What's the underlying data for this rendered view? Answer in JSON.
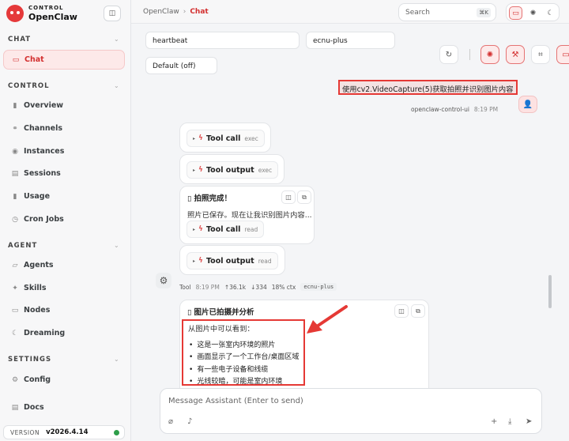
{
  "brand": {
    "sub": "CONTROL",
    "name": "OpenClaw"
  },
  "sidebar": {
    "sections": [
      {
        "label": "CHAT"
      },
      {
        "label": "CONTROL"
      },
      {
        "label": "AGENT"
      },
      {
        "label": "SETTINGS"
      }
    ],
    "items": [
      {
        "label": "Chat",
        "icon": "chat-icon"
      },
      {
        "label": "Overview",
        "icon": "bar-chart-icon"
      },
      {
        "label": "Channels",
        "icon": "link-icon"
      },
      {
        "label": "Instances",
        "icon": "broadcast-icon"
      },
      {
        "label": "Sessions",
        "icon": "document-icon"
      },
      {
        "label": "Usage",
        "icon": "bar-chart-icon"
      },
      {
        "label": "Cron Jobs",
        "icon": "clock-icon"
      },
      {
        "label": "Agents",
        "icon": "folder-icon"
      },
      {
        "label": "Skills",
        "icon": "sparkle-icon"
      },
      {
        "label": "Nodes",
        "icon": "monitor-icon"
      },
      {
        "label": "Dreaming",
        "icon": "moon-icon"
      },
      {
        "label": "Config",
        "icon": "gear-icon"
      },
      {
        "label": "Docs",
        "icon": "book-icon"
      }
    ],
    "version_label": "VERSION",
    "version": "v2026.4.14",
    "status_color": "#2e9e4a"
  },
  "topbar": {
    "breadcrumb_root": "OpenClaw",
    "breadcrumb_current": "Chat",
    "search_placeholder": "Search",
    "search_shortcut": "⌘K"
  },
  "session": {
    "field1": "heartbeat",
    "field2": "ecnu-plus",
    "field3": "Default (off)"
  },
  "user_message": {
    "text": "使用cv2.VideoCapture(5)获取拍照并识别图片内容",
    "sender": "openclaw-control-ui",
    "time": "8:19 PM"
  },
  "tools": {
    "call_label": "Tool call",
    "output_label": "Tool output",
    "exec": "exec",
    "read": "read"
  },
  "photo_card": {
    "title": "▯ 拍照完成！",
    "text": "照片已保存。现在让我识别图片内容..."
  },
  "meta": {
    "sender": "Tool",
    "time": "8:19 PM",
    "up": "↑36.1k",
    "down": "↓334",
    "ctx": "18% ctx",
    "model": "ecnu-plus"
  },
  "analysis_card": {
    "title": "▯ 图片已拍摄并分析",
    "intro": "从图片中可以看到：",
    "bullets": [
      "这是一张室内环境的照片",
      "画面显示了一个工作台/桌面区域",
      "有一些电子设备和线缆",
      "光线较暗，可能是室内环境"
    ]
  },
  "composer": {
    "placeholder": "Message Assistant (Enter to send)"
  },
  "colors": {
    "accent": "#d32f2f",
    "highlight": "#e53935"
  }
}
